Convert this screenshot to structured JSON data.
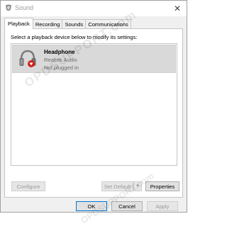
{
  "window": {
    "title": "Sound",
    "close_glyph": "✕"
  },
  "tabs": [
    {
      "label": "Playback",
      "active": true
    },
    {
      "label": "Recording",
      "active": false
    },
    {
      "label": "Sounds",
      "active": false
    },
    {
      "label": "Communications",
      "active": false
    }
  ],
  "playback": {
    "instruction": "Select a playback device below to modify its settings:",
    "devices": [
      {
        "name": "Headphone",
        "driver": "Realtek Audio",
        "status": "Not plugged in",
        "icon": "headphone-icon",
        "status_icon": "red-down-arrow-icon"
      }
    ],
    "buttons": {
      "configure": "Configure",
      "set_default": "Set Default",
      "dropdown_glyph": "▼",
      "properties": "Properties"
    }
  },
  "footer": {
    "ok": "OK",
    "cancel": "Cancel",
    "apply": "Apply"
  },
  "watermark": {
    "text": "OPDSUPPORT.com"
  },
  "colors": {
    "selection_bg": "#d9d9d9",
    "status_red": "#d0231c",
    "focus_border": "#0078d7"
  }
}
